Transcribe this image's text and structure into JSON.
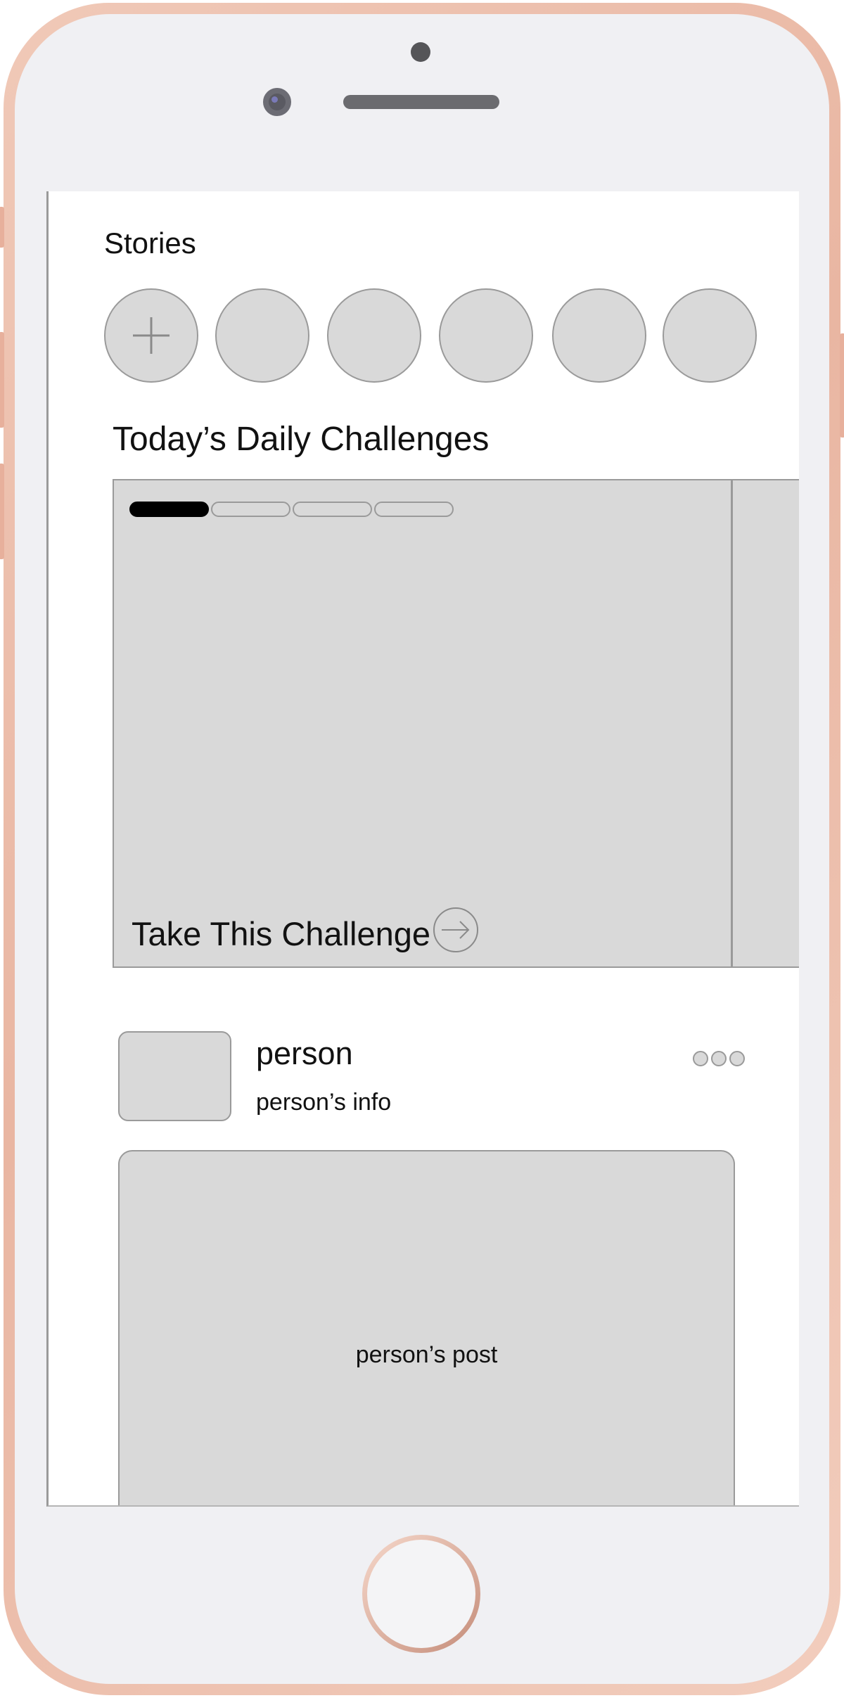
{
  "stories": {
    "title": "Stories",
    "items": [
      "add-story",
      "story",
      "story",
      "story",
      "story",
      "story"
    ]
  },
  "challenges": {
    "title": "Today’s Daily Challenges",
    "progress_segments": 4,
    "active_segment": 1,
    "take_label": "Take This Challenge"
  },
  "post": {
    "author_name": "person",
    "author_info": "person’s info",
    "content_label": "person’s post"
  },
  "icons": {
    "add": "plus-icon",
    "take": "arrow-right-circle-icon",
    "more": "more-dots-icon"
  },
  "colors": {
    "placeholder_fill": "#d9d9d9",
    "placeholder_border": "#9a9a9a",
    "active_progress": "#000000",
    "device_frame": "#e9b6a2"
  }
}
